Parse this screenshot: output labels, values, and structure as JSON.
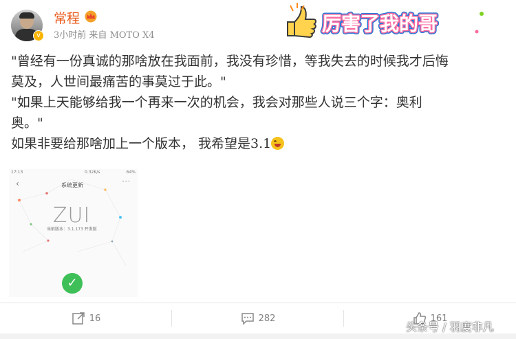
{
  "user": {
    "name": "常程",
    "time": "3小时前",
    "source_prefix": "来自",
    "device": "MOTO X4"
  },
  "sticker": {
    "text": "厉害了我的哥"
  },
  "post": {
    "line1": "\"曾经有一份真诚的那啥放在我面前，我没有珍惜，等我失去的时候我才后悔",
    "line2": "莫及，人世间最痛苦的事莫过于此。\"",
    "line3": "\"如果上天能够给我一个再来一次的机会，我会对那些人说三个字：奥利",
    "line4": "奥。\"",
    "line5": "如果非要给那啥加上一个版本，  我希望是3.1"
  },
  "screenshot": {
    "status_time": "17:13",
    "status_net": "0.32K/s",
    "status_battery": "64%",
    "title": "系统更新",
    "logo": "ZUI",
    "version": "当前版本：3.1.173 开发版"
  },
  "actions": {
    "repost_count": "16",
    "comment_count": "282",
    "like_count": "161"
  },
  "watermark": "头条号 / 羽度非凡",
  "colors": {
    "username": "#e8581a",
    "check": "#3fbf58"
  }
}
